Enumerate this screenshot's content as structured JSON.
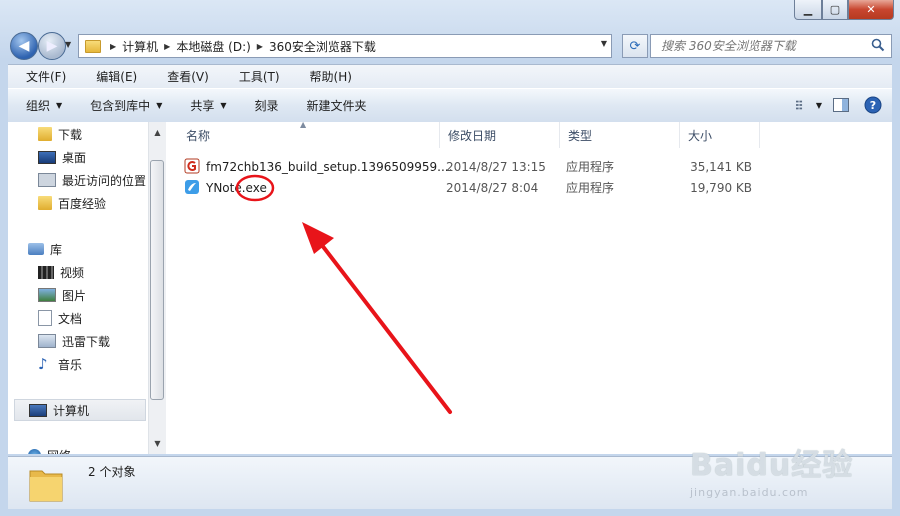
{
  "window": {
    "controls": {
      "minimize": "▁",
      "maximize": "▢",
      "close": "✕"
    }
  },
  "nav": {
    "breadcrumb": [
      "计算机",
      "本地磁盘 (D:)",
      "360安全浏览器下载"
    ],
    "search_placeholder": "搜索 360安全浏览器下载"
  },
  "menu": [
    "文件(F)",
    "编辑(E)",
    "查看(V)",
    "工具(T)",
    "帮助(H)"
  ],
  "commands": [
    {
      "label": "组织",
      "dropdown": true
    },
    {
      "label": "包含到库中",
      "dropdown": true
    },
    {
      "label": "共享",
      "dropdown": true
    },
    {
      "label": "刻录",
      "dropdown": false
    },
    {
      "label": "新建文件夹",
      "dropdown": false
    }
  ],
  "tree": [
    {
      "label": "下载",
      "icon": "folder-icon",
      "section": "favorites"
    },
    {
      "label": "桌面",
      "icon": "desktop-icon",
      "section": "favorites"
    },
    {
      "label": "最近访问的位置",
      "icon": "recent-places-icon",
      "section": "favorites"
    },
    {
      "label": "百度经验",
      "icon": "folder-icon",
      "section": "favorites"
    },
    {
      "label": "库",
      "icon": "library-icon",
      "section": "libraries"
    },
    {
      "label": "视频",
      "icon": "video-icon",
      "section": "libraries"
    },
    {
      "label": "图片",
      "icon": "pictures-icon",
      "section": "libraries"
    },
    {
      "label": "文档",
      "icon": "documents-icon",
      "section": "libraries"
    },
    {
      "label": "迅雷下载",
      "icon": "thunder-download-icon",
      "section": "libraries"
    },
    {
      "label": "音乐",
      "icon": "music-icon",
      "section": "libraries"
    },
    {
      "label": "计算机",
      "icon": "computer-icon",
      "section": "computer",
      "selected": true
    },
    {
      "label": "网络",
      "icon": "network-icon",
      "section": "network"
    }
  ],
  "columns": {
    "name": "名称",
    "date": "修改日期",
    "type": "类型",
    "size": "大小"
  },
  "files": [
    {
      "name": "fm72chb136_build_setup.1396509959....",
      "date": "2014/8/27 13:15",
      "type": "应用程序",
      "size": "35,141 KB",
      "icon": "installer-app-icon"
    },
    {
      "name": "YNote.exe",
      "date": "2014/8/27 8:04",
      "type": "应用程序",
      "size": "19,790 KB",
      "icon": "ynote-app-icon"
    }
  ],
  "status": {
    "count": "2 个对象"
  },
  "watermark": {
    "brand": "Baidu经验",
    "url": "jingyan.baidu.com"
  },
  "colors": {
    "annotation_red": "#e8141a",
    "selection": "#e2e6ec",
    "header_text": "#3c4d66"
  }
}
